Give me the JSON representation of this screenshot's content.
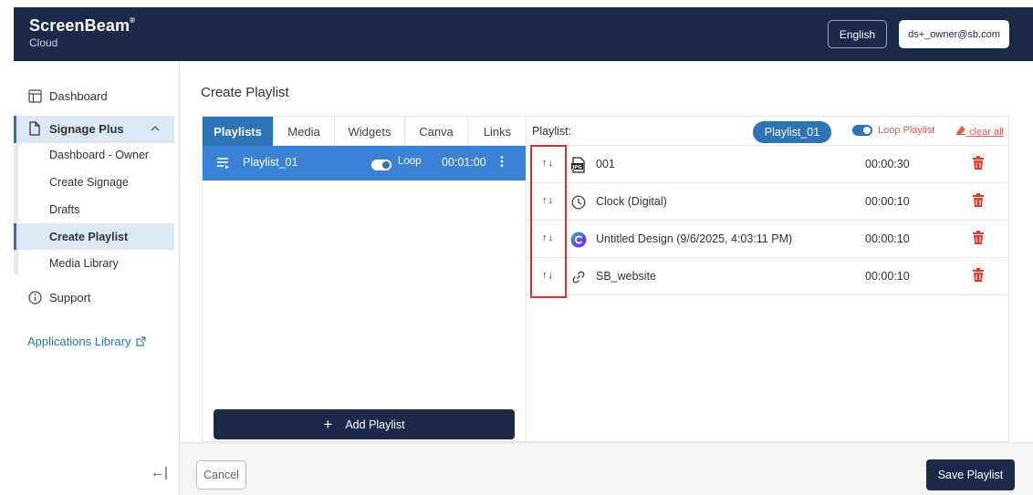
{
  "header": {
    "brand": "ScreenBeam",
    "brand_mark": "®",
    "subtitle": "Cloud",
    "language_label": "English",
    "user_email": "ds+_owner@sb.com",
    "bg_color": "#1b2a4a"
  },
  "sidebar": {
    "dashboard": "Dashboard",
    "signage_plus": "Signage Plus",
    "sub_items": [
      "Dashboard - Owner",
      "Create Signage",
      "Drafts",
      "Create Playlist",
      "Media Library"
    ],
    "support": "Support",
    "applications_library": "Applications Library",
    "collapse_glyph": "←|"
  },
  "main": {
    "page_title": "Create Playlist",
    "tabs": [
      "Playlists",
      "Media",
      "Widgets",
      "Canva",
      "Links"
    ],
    "active_tab": "Playlists",
    "playlist_row": {
      "name": "Playlist_01",
      "loop_label": "Loop",
      "duration": "00:01:00"
    },
    "add_playlist_label": "Add Playlist",
    "playlist_header_label": "Playlist:",
    "selected_playlist": "Playlist_01",
    "loop_playlist_label": "Loop Playlist",
    "clear_all_label": "clear all",
    "arrows_glyph": "↑↓",
    "items": [
      {
        "name": "001",
        "duration": "00:00:30",
        "icon": "jpg-file-icon"
      },
      {
        "name": "Clock (Digital)",
        "duration": "00:00:10",
        "icon": "clock-icon"
      },
      {
        "name": "Untitled Design (9/6/2025, 4:03:11 PM)",
        "duration": "00:00:10",
        "icon": "canva-icon"
      },
      {
        "name": "SB_website",
        "duration": "00:00:10",
        "icon": "link-icon"
      }
    ]
  },
  "footer": {
    "cancel_label": "Cancel",
    "save_label": "Save Playlist"
  },
  "colors": {
    "accent": "#2c74b3",
    "danger": "#e05a4f",
    "highlight_box": "#d8312b"
  }
}
